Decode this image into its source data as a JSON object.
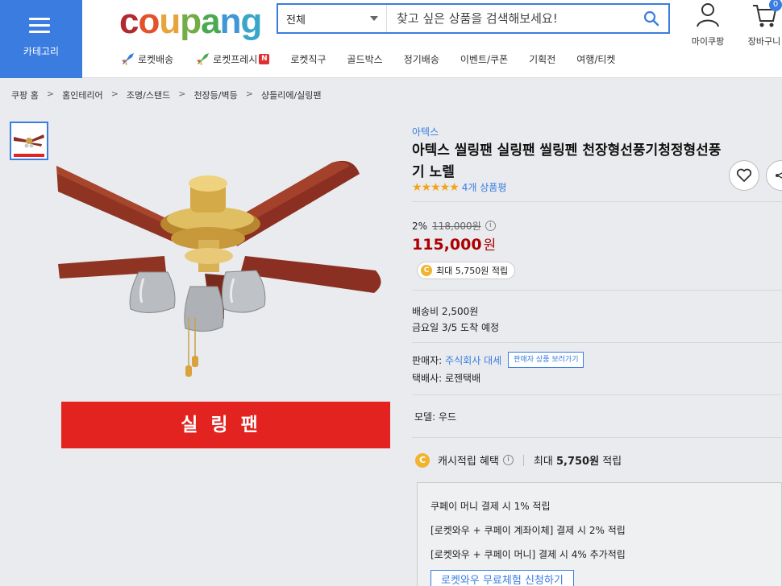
{
  "header": {
    "category_label": "카테고리",
    "logo_letters": [
      {
        "ch": "c",
        "color": "#b2282e"
      },
      {
        "ch": "o",
        "color": "#e3522b"
      },
      {
        "ch": "u",
        "color": "#e8a33a"
      },
      {
        "ch": "p",
        "color": "#74ad45"
      },
      {
        "ch": "a",
        "color": "#4aaa52"
      },
      {
        "ch": "n",
        "color": "#3f97d6"
      },
      {
        "ch": "g",
        "color": "#3aa5c9"
      }
    ],
    "search": {
      "category": "전체",
      "placeholder": "찾고 싶은 상품을 검색해보세요!"
    },
    "mypage_label": "마이쿠팡",
    "cart_label": "장바구니",
    "cart_count": "0",
    "nav": [
      {
        "label": "로켓배송",
        "icon": "rocket-icon"
      },
      {
        "label": "로켓프레시",
        "icon": "rocket-fresh-icon",
        "badge": "N"
      },
      {
        "label": "로켓직구"
      },
      {
        "label": "골드박스"
      },
      {
        "label": "정기배송"
      },
      {
        "label": "이벤트/쿠폰"
      },
      {
        "label": "기획전"
      },
      {
        "label": "여행/티켓"
      }
    ]
  },
  "breadcrumb": [
    "쿠팡 홈",
    "홈인테리어",
    "조명/스탠드",
    "천장등/벽등",
    "샹들리에/실링팬"
  ],
  "gallery": {
    "banner_text": "실링팬"
  },
  "product": {
    "brand": "아텍스",
    "title": "아텍스 씰링팬 실링팬 씰링펜 천장형선풍기청정형선풍기 노렐",
    "stars": "★★★★★",
    "review_count": "4개 상품평",
    "discount_rate": "2%",
    "original_price": "118,000원",
    "sale_price": "115,000",
    "currency": "원",
    "reward_pill": "최대 5,750원 적립",
    "shipping_fee": "배송비 2,500원",
    "arrival": "금요일 3/5 도착 예정",
    "seller_label": "판매자:",
    "seller_name": "주식회사 대세",
    "seller_products_button": "판매자 상품 보러가기",
    "courier": "택배사: 로젠택배",
    "model": "모델: 우드"
  },
  "cash_reward": {
    "label": "캐시적립 혜택",
    "max_prefix": "최대",
    "max_amount": "5,750원",
    "max_suffix": "적립",
    "lines": [
      "쿠페이 머니 결제 시 1% 적립",
      "[로켓와우 + 쿠페이 계좌이체] 결제 시 2% 적립",
      "[로켓와우 + 쿠페이 머니] 결제 시 4% 추가적립"
    ],
    "subscribe_button": "로켓와우 무료체험 신청하기"
  },
  "colors": {
    "accent_blue": "#3a7ce0",
    "price_red": "#ae0000",
    "banner_red": "#e3231f",
    "star_yellow": "#f4a316"
  }
}
